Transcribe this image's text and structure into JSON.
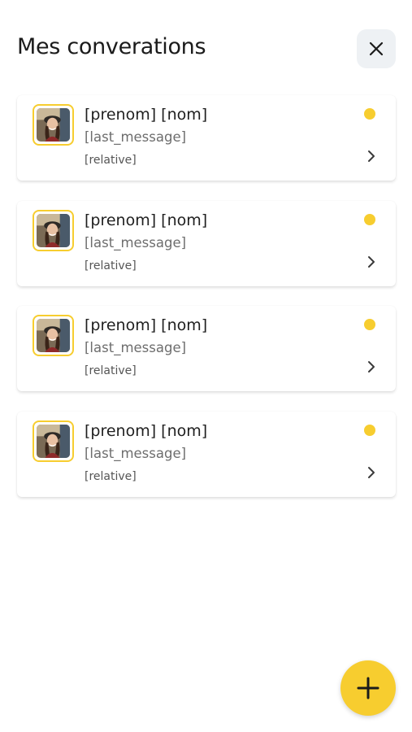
{
  "header": {
    "title": "Mes converations",
    "close_icon": "close-icon"
  },
  "conversations": [
    {
      "name": "[prenom] [nom]",
      "last_message": "[last_message]",
      "relative": "[relative]",
      "unread": true
    },
    {
      "name": "[prenom] [nom]",
      "last_message": "[last_message]",
      "relative": "[relative]",
      "unread": true
    },
    {
      "name": "[prenom] [nom]",
      "last_message": "[last_message]",
      "relative": "[relative]",
      "unread": true
    },
    {
      "name": "[prenom] [nom]",
      "last_message": "[last_message]",
      "relative": "[relative]",
      "unread": true
    }
  ],
  "fab": {
    "icon": "plus-icon"
  },
  "colors": {
    "accent": "#f7cd2f",
    "close_bg": "#eef1f4",
    "text_primary": "#1f1f1f",
    "text_secondary": "#6d6d6d"
  }
}
